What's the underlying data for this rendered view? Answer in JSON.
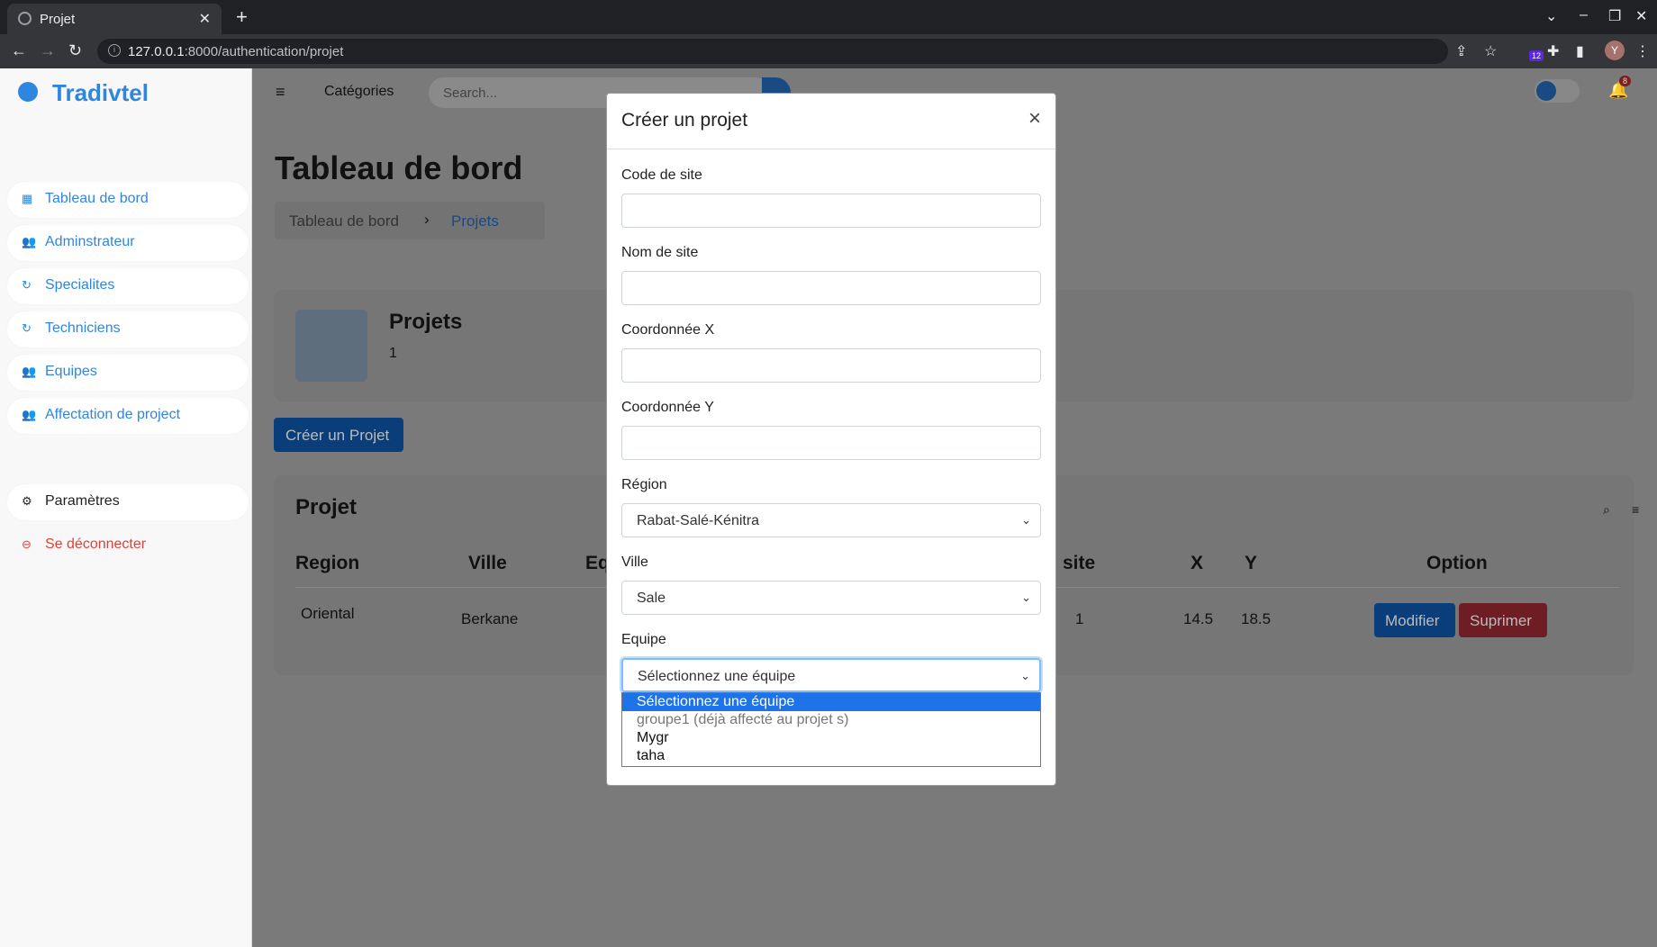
{
  "browser": {
    "tab_title": "Projet",
    "url_host": "127.0.0.1",
    "url_rest": ":8000/authentication/projet",
    "ext_badge": "12",
    "avatar_letter": "Y"
  },
  "sidebar": {
    "brand": "Tradivtel",
    "items": [
      {
        "label": "Tableau de bord"
      },
      {
        "label": "Adminstrateur"
      },
      {
        "label": "Specialites"
      },
      {
        "label": "Techniciens"
      },
      {
        "label": "Equipes"
      },
      {
        "label": "Affectation de project"
      }
    ],
    "settings_label": "Paramètres",
    "logout_label": "Se déconnecter"
  },
  "topnav": {
    "categories": "Catégories",
    "search_placeholder": "Search...",
    "notif_count": "8"
  },
  "page": {
    "title": "Tableau de bord",
    "breadcrumb": [
      "Tableau de bord",
      "Projets"
    ],
    "stat_title": "Projets",
    "stat_value": "1",
    "create_button": "Créer un Projet",
    "table_title": "Projet",
    "columns": [
      "Region",
      "Ville",
      "Eq",
      "site",
      "X",
      "Y",
      "Option"
    ],
    "row": {
      "region": "Oriental",
      "ville": "Berkane",
      "site": "1",
      "x": "14.5",
      "y": "18.5"
    },
    "edit_button": "Modifier",
    "delete_button": "Suprimer"
  },
  "modal": {
    "title": "Créer un projet",
    "close": "×",
    "fields": {
      "code_label": "Code de site",
      "nom_label": "Nom de site",
      "x_label": "Coordonnée X",
      "y_label": "Coordonnée Y",
      "region_label": "Région",
      "region_value": "Rabat-Salé-Kénitra",
      "ville_label": "Ville",
      "ville_value": "Sale",
      "equipe_label": "Equipe",
      "equipe_value": "Sélectionnez une équipe"
    },
    "equipe_options": [
      "Sélectionnez une équipe",
      "groupe1 (déjà affecté au projet s)",
      "Mygr",
      "taha"
    ]
  }
}
